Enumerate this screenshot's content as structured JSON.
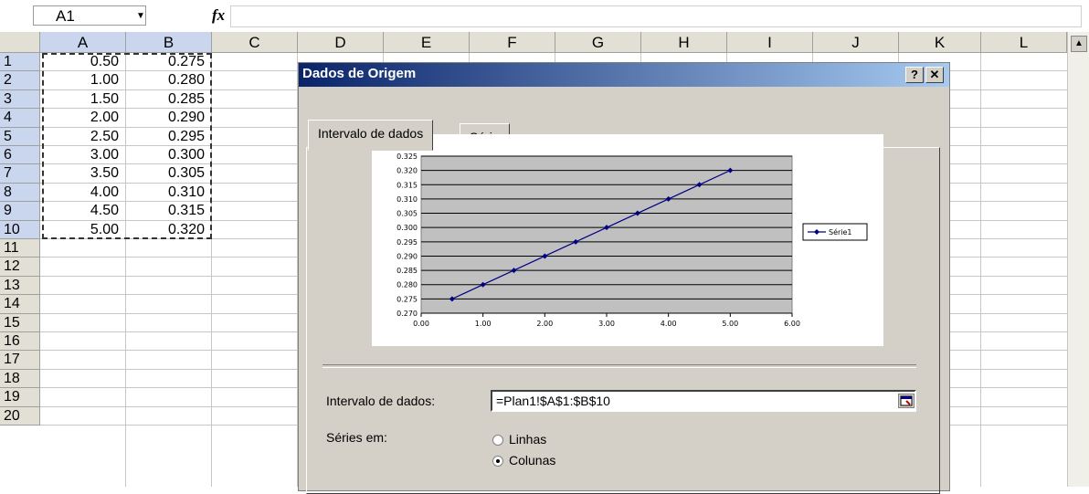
{
  "formula_bar": {
    "name_box": "A1",
    "fx": "fx",
    "formula": ""
  },
  "columns": [
    "A",
    "B",
    "C",
    "D",
    "E",
    "F",
    "G",
    "H",
    "I",
    "J",
    "K",
    "L"
  ],
  "rows": [
    "1",
    "2",
    "3",
    "4",
    "5",
    "6",
    "7",
    "8",
    "9",
    "10",
    "11",
    "12",
    "13",
    "14",
    "15",
    "16",
    "17",
    "18",
    "19",
    "20"
  ],
  "cells": {
    "A": [
      "0.50",
      "1.00",
      "1.50",
      "2.00",
      "2.50",
      "3.00",
      "3.50",
      "4.00",
      "4.50",
      "5.00"
    ],
    "B": [
      "0.275",
      "0.280",
      "0.285",
      "0.290",
      "0.295",
      "0.300",
      "0.305",
      "0.310",
      "0.315",
      "0.320"
    ]
  },
  "dialog": {
    "title": "Dados de Origem",
    "help_label": "?",
    "close_label": "✕",
    "tabs": [
      {
        "label": "Intervalo de dados",
        "active": true
      },
      {
        "label": "Série",
        "active": false
      }
    ],
    "range_label": "Intervalo de dados:",
    "range_value": "=Plan1!$A$1:$B$10",
    "series_in_label": "Séries em:",
    "series_options": [
      {
        "label": "Linhas",
        "checked": false
      },
      {
        "label": "Colunas",
        "checked": true
      }
    ]
  },
  "chart_data": {
    "type": "line",
    "x": [
      0.5,
      1.0,
      1.5,
      2.0,
      2.5,
      3.0,
      3.5,
      4.0,
      4.5,
      5.0
    ],
    "series": [
      {
        "name": "Série1",
        "values": [
          0.275,
          0.28,
          0.285,
          0.29,
          0.295,
          0.3,
          0.305,
          0.31,
          0.315,
          0.32
        ]
      }
    ],
    "xlim": [
      0.0,
      6.0
    ],
    "ylim": [
      0.27,
      0.325
    ],
    "x_ticks": [
      "0.00",
      "1.00",
      "2.00",
      "3.00",
      "4.00",
      "5.00",
      "6.00"
    ],
    "y_ticks": [
      "0.270",
      "0.275",
      "0.280",
      "0.285",
      "0.290",
      "0.295",
      "0.300",
      "0.305",
      "0.310",
      "0.315",
      "0.320",
      "0.325"
    ],
    "legend": "right",
    "grid": true,
    "plot_area_color": "#c0c0c0",
    "line_color": "#000080"
  }
}
